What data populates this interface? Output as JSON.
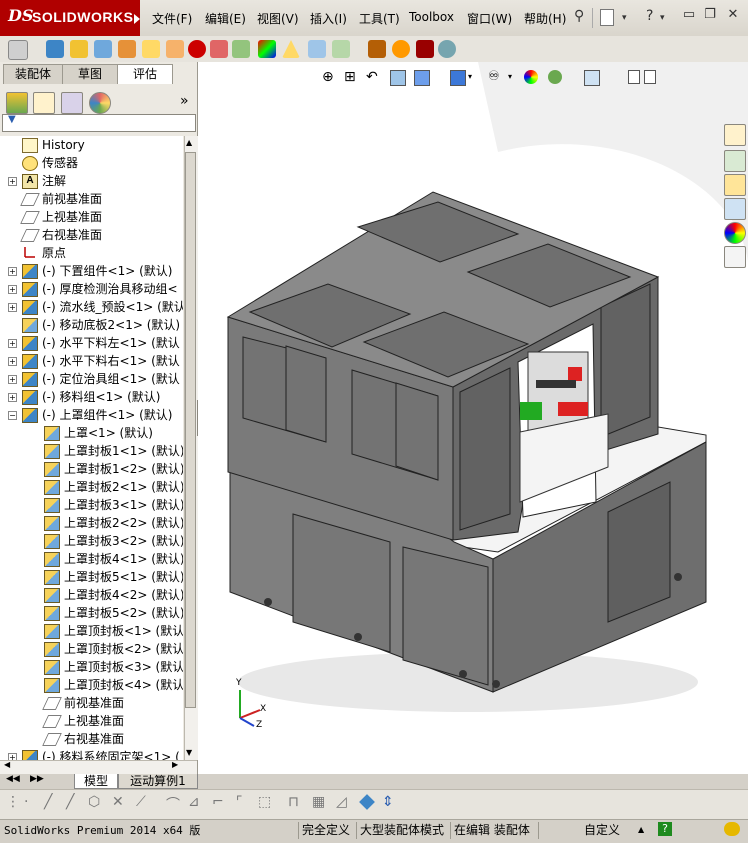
{
  "app": {
    "brand": "SOLIDWORKS",
    "logo_ds": "DS"
  },
  "menu": {
    "items": [
      "文件(F)",
      "编辑(E)",
      "视图(V)",
      "插入(I)",
      "工具(T)",
      "Toolbox",
      "窗口(W)",
      "帮助(H)"
    ]
  },
  "window_controls": {
    "help": "?",
    "minimize": "▭",
    "restore": "❐",
    "close": "✕"
  },
  "feature_manager": {
    "tabs": [
      "装配体",
      "草图",
      "评估"
    ],
    "active_tab": "评估",
    "expand_arrow": "»",
    "filter_glyph": "▼"
  },
  "tree": [
    {
      "indent": 0,
      "expand": "",
      "icon": "history",
      "label": "History"
    },
    {
      "indent": 0,
      "expand": "",
      "icon": "sensor",
      "label": "传感器"
    },
    {
      "indent": 0,
      "expand": "+",
      "icon": "annotation",
      "label": "注解"
    },
    {
      "indent": 0,
      "expand": "",
      "icon": "plane",
      "label": "前视基准面"
    },
    {
      "indent": 0,
      "expand": "",
      "icon": "plane",
      "label": "上视基准面"
    },
    {
      "indent": 0,
      "expand": "",
      "icon": "plane",
      "label": "右视基准面"
    },
    {
      "indent": 0,
      "expand": "",
      "icon": "origin",
      "label": "原点"
    },
    {
      "indent": 0,
      "expand": "+",
      "icon": "assembly",
      "label": "(-) 下置组件<1> (默认)"
    },
    {
      "indent": 0,
      "expand": "+",
      "icon": "assembly",
      "label": "(-) 厚度检测治具移动组<"
    },
    {
      "indent": 0,
      "expand": "+",
      "icon": "assembly",
      "label": "(-) 流水线_预設<1> (默认"
    },
    {
      "indent": 0,
      "expand": "",
      "icon": "part",
      "label": "(-) 移动底板2<1> (默认)"
    },
    {
      "indent": 0,
      "expand": "+",
      "icon": "assembly",
      "label": "(-) 水平下料左<1> (默认"
    },
    {
      "indent": 0,
      "expand": "+",
      "icon": "assembly",
      "label": "(-) 水平下料右<1> (默认"
    },
    {
      "indent": 0,
      "expand": "+",
      "icon": "assembly",
      "label": "(-) 定位治具组<1> (默认"
    },
    {
      "indent": 0,
      "expand": "+",
      "icon": "assembly",
      "label": "(-) 移料组<1> (默认)"
    },
    {
      "indent": 0,
      "expand": "−",
      "icon": "assembly",
      "label": "(-) 上罩组件<1> (默认)"
    },
    {
      "indent": 1,
      "expand": "",
      "icon": "part",
      "label": "上罩<1> (默认)"
    },
    {
      "indent": 1,
      "expand": "",
      "icon": "part",
      "label": "上罩封板1<1> (默认)"
    },
    {
      "indent": 1,
      "expand": "",
      "icon": "part",
      "label": "上罩封板1<2> (默认)"
    },
    {
      "indent": 1,
      "expand": "",
      "icon": "part",
      "label": "上罩封板2<1> (默认)"
    },
    {
      "indent": 1,
      "expand": "",
      "icon": "part",
      "label": "上罩封板3<1> (默认)"
    },
    {
      "indent": 1,
      "expand": "",
      "icon": "part",
      "label": "上罩封板2<2> (默认)"
    },
    {
      "indent": 1,
      "expand": "",
      "icon": "part",
      "label": "上罩封板3<2> (默认)"
    },
    {
      "indent": 1,
      "expand": "",
      "icon": "part",
      "label": "上罩封板4<1> (默认)"
    },
    {
      "indent": 1,
      "expand": "",
      "icon": "part",
      "label": "上罩封板5<1> (默认)"
    },
    {
      "indent": 1,
      "expand": "",
      "icon": "part",
      "label": "上罩封板4<2> (默认)"
    },
    {
      "indent": 1,
      "expand": "",
      "icon": "part",
      "label": "上罩封板5<2> (默认)"
    },
    {
      "indent": 1,
      "expand": "",
      "icon": "part",
      "label": "上罩顶封板<1> (默认)"
    },
    {
      "indent": 1,
      "expand": "",
      "icon": "part",
      "label": "上罩顶封板<2> (默认)"
    },
    {
      "indent": 1,
      "expand": "",
      "icon": "part",
      "label": "上罩顶封板<3> (默认)"
    },
    {
      "indent": 1,
      "expand": "",
      "icon": "part",
      "label": "上罩顶封板<4> (默认)"
    },
    {
      "indent": 1,
      "expand": "",
      "icon": "plane",
      "label": "前视基准面"
    },
    {
      "indent": 1,
      "expand": "",
      "icon": "plane",
      "label": "上视基准面"
    },
    {
      "indent": 1,
      "expand": "",
      "icon": "plane",
      "label": "右视基准面"
    },
    {
      "indent": 0,
      "expand": "+",
      "icon": "assembly",
      "label": "(-) 移料系统固定架<1> ("
    }
  ],
  "bottom_tabs": [
    "模型",
    "运动算例1"
  ],
  "active_bottom_tab": "模型",
  "triad": {
    "x": "X",
    "y": "Y",
    "z": "Z"
  },
  "status": {
    "product": "SolidWorks Premium 2014 x64 版",
    "fields": [
      "完全定义",
      "大型装配体模式",
      "在编辑 装配体",
      "自定义"
    ],
    "help_glyph": "?"
  },
  "colors": {
    "brand_red": "#b00000",
    "machine_gray": "#7f7f7f",
    "machine_dark": "#5a5a5a",
    "panel_bg": "#ece9e2"
  }
}
